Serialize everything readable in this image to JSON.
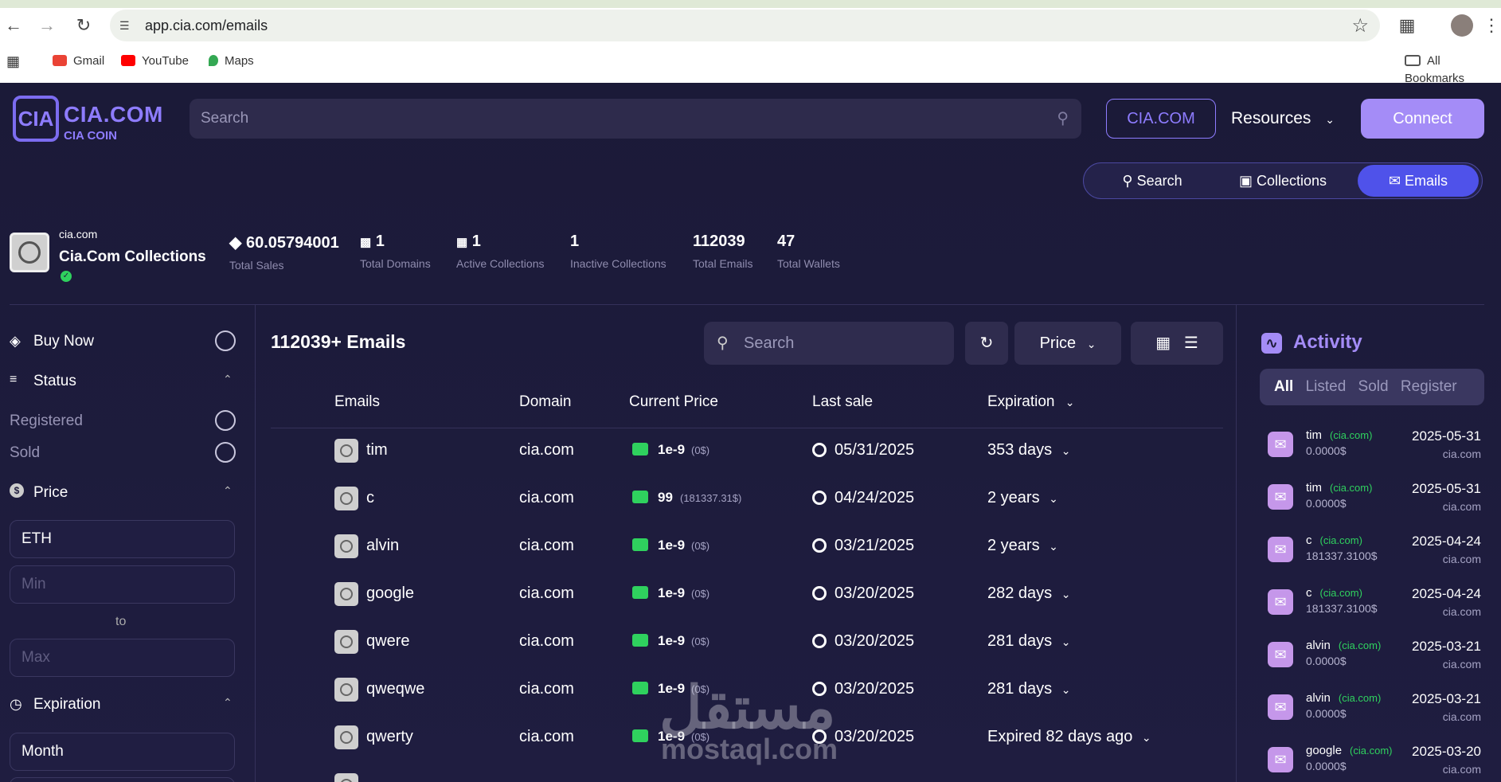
{
  "browser": {
    "url": "app.cia.com/emails",
    "bookmarks": [
      {
        "label": "Gmail",
        "icon": "gmail-icon",
        "color": "#ea4335"
      },
      {
        "label": "YouTube",
        "icon": "youtube-icon",
        "color": "#ff0000"
      },
      {
        "label": "Maps",
        "icon": "maps-pin-icon",
        "color": "#34a853"
      }
    ],
    "all_bookmarks_label": "All Bookmarks"
  },
  "header": {
    "logo_mark": "CIA",
    "logo_title": "CIA.COM",
    "logo_subtitle": "CIA COIN",
    "search_placeholder": "Search",
    "brand_button": "CIA.COM",
    "resources_label": "Resources",
    "connect_label": "Connect",
    "accent": "#a48cf7"
  },
  "nav_tabs": [
    {
      "label": "Search",
      "icon": "search-icon",
      "active": false
    },
    {
      "label": "Collections",
      "icon": "collections-icon",
      "active": false
    },
    {
      "label": "Emails",
      "icon": "mail-icon",
      "active": true
    }
  ],
  "collection": {
    "domain": "cia.com",
    "name": "Cia.Com Collections",
    "verified": true,
    "stats": [
      {
        "value": "60.05794001",
        "label": "Total Sales",
        "icon": "ethereum-icon"
      },
      {
        "value": "1",
        "label": "Total Domains",
        "icon": "domains-icon"
      },
      {
        "value": "1",
        "label": "Active Collections",
        "icon": "building-icon"
      },
      {
        "value": "1",
        "label": "Inactive Collections",
        "icon": ""
      },
      {
        "value": "112039",
        "label": "Total Emails",
        "icon": ""
      },
      {
        "value": "47",
        "label": "Total Wallets",
        "icon": ""
      }
    ]
  },
  "sidebar": {
    "buy_now": "Buy Now",
    "status": "Status",
    "registered": "Registered",
    "sold": "Sold",
    "price": "Price",
    "currency": "ETH",
    "min_placeholder": "Min",
    "to": "to",
    "max_placeholder": "Max",
    "expiration": "Expiration",
    "expiration_value": "Month"
  },
  "main": {
    "title": "112039+ Emails",
    "search_placeholder": "Search",
    "sort_label": "Price",
    "columns": [
      "Emails",
      "Domain",
      "Current Price",
      "Last sale",
      "Expiration"
    ],
    "rows": [
      {
        "name": "tim",
        "domain": "cia.com",
        "price": "1e-9",
        "usd": "(0$)",
        "last_sale": "05/31/2025",
        "expiration": "353 days"
      },
      {
        "name": "c",
        "domain": "cia.com",
        "price": "99",
        "usd": "(181337.31$)",
        "last_sale": "04/24/2025",
        "expiration": "2 years"
      },
      {
        "name": "alvin",
        "domain": "cia.com",
        "price": "1e-9",
        "usd": "(0$)",
        "last_sale": "03/21/2025",
        "expiration": "2 years"
      },
      {
        "name": "google",
        "domain": "cia.com",
        "price": "1e-9",
        "usd": "(0$)",
        "last_sale": "03/20/2025",
        "expiration": "282 days"
      },
      {
        "name": "qwere",
        "domain": "cia.com",
        "price": "1e-9",
        "usd": "(0$)",
        "last_sale": "03/20/2025",
        "expiration": "281 days"
      },
      {
        "name": "qweqwe",
        "domain": "cia.com",
        "price": "1e-9",
        "usd": "(0$)",
        "last_sale": "03/20/2025",
        "expiration": "281 days"
      },
      {
        "name": "qwerty",
        "domain": "cia.com",
        "price": "1e-9",
        "usd": "(0$)",
        "last_sale": "03/20/2025",
        "expiration": "Expired 82 days ago"
      }
    ]
  },
  "activity": {
    "title": "Activity",
    "filters": [
      "All",
      "Listed",
      "Sold",
      "Register"
    ],
    "active_filter": "All",
    "items": [
      {
        "name": "tim",
        "domain": "(cia.com)",
        "amount": "0.0000$",
        "date": "2025-05-31",
        "site": "cia.com"
      },
      {
        "name": "tim",
        "domain": "(cia.com)",
        "amount": "0.0000$",
        "date": "2025-05-31",
        "site": "cia.com"
      },
      {
        "name": "c",
        "domain": "(cia.com)",
        "amount": "181337.3100$",
        "date": "2025-04-24",
        "site": "cia.com"
      },
      {
        "name": "c",
        "domain": "(cia.com)",
        "amount": "181337.3100$",
        "date": "2025-04-24",
        "site": "cia.com"
      },
      {
        "name": "alvin",
        "domain": "(cia.com)",
        "amount": "0.0000$",
        "date": "2025-03-21",
        "site": "cia.com"
      },
      {
        "name": "alvin",
        "domain": "(cia.com)",
        "amount": "0.0000$",
        "date": "2025-03-21",
        "site": "cia.com"
      },
      {
        "name": "google",
        "domain": "(cia.com)",
        "amount": "0.0000$",
        "date": "2025-03-20",
        "site": "cia.com"
      }
    ]
  },
  "watermark": {
    "arabic": "مستقل",
    "latin": "mostaql.com"
  }
}
